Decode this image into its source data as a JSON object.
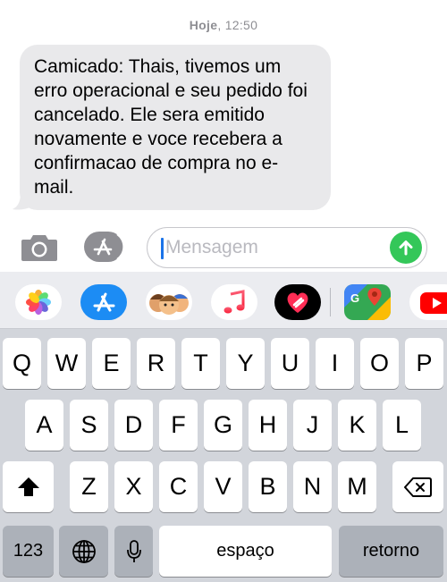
{
  "conversation": {
    "timestamp_day": "Hoje",
    "timestamp_time": ", 12:50",
    "message": "Camicado: Thais, tivemos um erro operacional e seu pedido foi cancelado. Ele sera emitido novamente e voce recebera a confirmacao de compra no e-mail."
  },
  "compose": {
    "placeholder": "Mensagem",
    "camera_icon": "camera-icon",
    "apps_icon": "app-store-icon",
    "send_icon": "send-arrow-icon",
    "send_color": "#34c759"
  },
  "app_strip": [
    {
      "name": "photos-icon"
    },
    {
      "name": "app-store-icon"
    },
    {
      "name": "memoji-icon"
    },
    {
      "name": "music-icon"
    },
    {
      "name": "digital-touch-icon"
    },
    {
      "name": "google-maps-icon"
    },
    {
      "name": "youtube-icon"
    }
  ],
  "keyboard": {
    "row1": [
      "Q",
      "W",
      "E",
      "R",
      "T",
      "Y",
      "U",
      "I",
      "O",
      "P"
    ],
    "row2": [
      "A",
      "S",
      "D",
      "F",
      "G",
      "H",
      "J",
      "K",
      "L"
    ],
    "row3": [
      "Z",
      "X",
      "C",
      "V",
      "B",
      "N",
      "M"
    ],
    "numbers_label": "123",
    "space_label": "espaço",
    "return_label": "retorno",
    "shift_icon": "shift-icon",
    "delete_icon": "delete-icon",
    "globe_icon": "globe-icon",
    "mic_icon": "microphone-icon"
  }
}
